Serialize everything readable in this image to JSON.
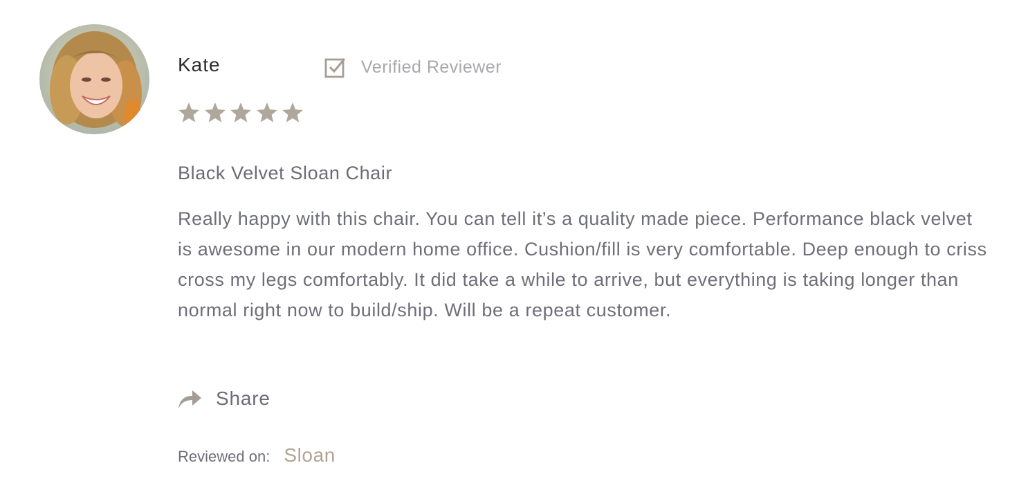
{
  "reviewer": {
    "name": "Kate",
    "verified_label": "Verified Reviewer",
    "avatar_icon": "avatar-photo"
  },
  "rating": {
    "stars": 5,
    "max": 5,
    "star_color": "#b0a79c"
  },
  "review": {
    "title": "Black Velvet Sloan Chair",
    "body": "Really happy with this chair. You can tell it’s a quality made piece. Performance black velvet is awesome in our modern home office. Cushion/fill is very comfortable. Deep enough to criss cross my legs comfortably. It did take a while to arrive, but everything is taking longer than normal right now to build/ship. Will be a repeat customer."
  },
  "actions": {
    "share_label": "Share",
    "share_icon": "share-arrow-icon"
  },
  "reviewed_on": {
    "label": "Reviewed on:",
    "product_link": "Sloan"
  },
  "colors": {
    "accent": "#b1a392",
    "icon": "#a59d95",
    "text": "#6e6e78"
  }
}
